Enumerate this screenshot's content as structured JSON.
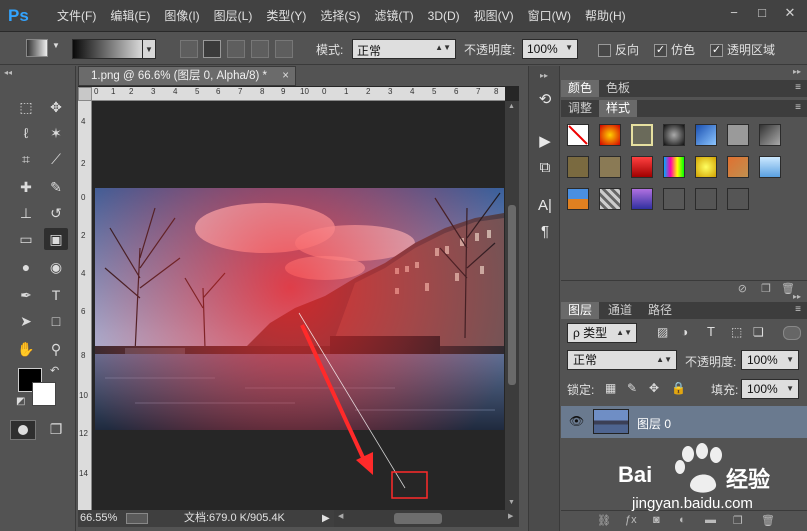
{
  "app": {
    "logo": "Ps"
  },
  "menu": [
    "文件(F)",
    "编辑(E)",
    "图像(I)",
    "图层(L)",
    "类型(Y)",
    "选择(S)",
    "滤镜(T)",
    "3D(D)",
    "视图(V)",
    "窗口(W)",
    "帮助(H)"
  ],
  "window_controls": [
    "−",
    "□",
    "✕"
  ],
  "options": {
    "mode_label": "模式:",
    "mode_value": "正常",
    "opacity_label": "不透明度:",
    "opacity_value": "100%",
    "reverse_label": "反向",
    "dither_label": "仿色",
    "transparency_label": "透明区域",
    "reverse_checked": false,
    "dither_checked": true,
    "transparency_checked": true
  },
  "document": {
    "tab_title": "1.png @ 66.6% (图层 0, Alpha/8) *",
    "tab_close": "×",
    "zoom": "66.55%",
    "doc_size": "文档:679.0 K/905.4K"
  },
  "rulers": {
    "h_ticks": [
      "0",
      "1",
      "2",
      "3",
      "4",
      "5",
      "6",
      "7",
      "8",
      "9",
      "10",
      "0",
      "1",
      "2",
      "3",
      "4",
      "5",
      "6",
      "7",
      "8",
      "9"
    ],
    "v_ticks": [
      "4",
      "2",
      "0",
      "2",
      "4",
      "6",
      "8",
      "10",
      "12",
      "14"
    ]
  },
  "panels": {
    "color_tab": "颜色",
    "swatches_tab": "色板",
    "adjustments_tab": "调整",
    "styles_tab": "样式",
    "layers_tab": "图层",
    "channels_tab": "通道",
    "paths_tab": "路径"
  },
  "layers": {
    "filter_label": "ρ 类型",
    "blend_mode": "正常",
    "opacity_label": "不透明度:",
    "opacity_value": "100%",
    "lock_label": "锁定:",
    "fill_label": "填充:",
    "fill_value": "100%",
    "layer_name": "图层 0"
  },
  "watermark": {
    "brand": "Bai",
    "brand_suffix": "经验",
    "url": "jingyan.baidu.com"
  },
  "colors": {
    "ps_blue": "#31a8ff",
    "selected_layer": "#6a7a8f",
    "arrow_red": "#ff2a2a"
  }
}
